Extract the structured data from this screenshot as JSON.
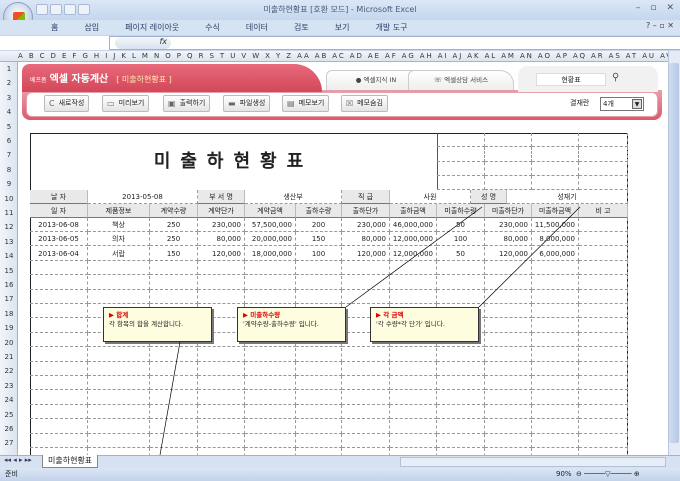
{
  "window": {
    "title": "미출하현황표  [호환 모드] - Microsoft Excel",
    "controls": [
      "–",
      "▫",
      "✕"
    ]
  },
  "ribbon": {
    "tabs": [
      "홈",
      "삽입",
      "페이지 레이아웃",
      "수식",
      "데이터",
      "검토",
      "보기",
      "개발 도구"
    ],
    "right": "? – ▫ ✕"
  },
  "formula_bar": {
    "fx": "fx",
    "value": ""
  },
  "columns": "A B C D E F G H I J K L M N O P Q R S T U V W X Y Z AA AB AC AD AE AF AG AH AI AJ AK AL AM AN AO AP AQ AR AS AT AU AV AW AX AY AZ BB BC BE",
  "banner": {
    "brand_small": "베프폼",
    "brand": "엑셀 자동계산",
    "subtitle": "[ 미출하현황표 ]",
    "tab1": "엑셀지식 IN",
    "tab2": "엑셀상담 서비스",
    "search_value": "현황표"
  },
  "toolbar": {
    "buttons": [
      "새로작성",
      "미리보기",
      "출력하기",
      "파일생성",
      "메모보기",
      "메모숨김"
    ],
    "approval_label": "결재란",
    "approval_value": "4개"
  },
  "form": {
    "title": "미출하현황표",
    "info": {
      "date_label": "날 자",
      "date": "2013-05-08",
      "dept_label": "부 서 명",
      "dept": "생산부",
      "rank_label": "직 급",
      "rank": "사원",
      "name_label": "성 명",
      "name": "성재기"
    },
    "headers": [
      "일 자",
      "제품정보",
      "계약수량",
      "계약단가",
      "계약금액",
      "출하수량",
      "출하단가",
      "출하금액",
      "미출하수량",
      "미출하단가",
      "미출하금액",
      "비 고"
    ],
    "rows": [
      [
        "2013-06-08",
        "책상",
        "250",
        "230,000",
        "57,500,000",
        "200",
        "230,000",
        "46,000,000",
        "50",
        "230,000",
        "11,500,000",
        ""
      ],
      [
        "2013-06-05",
        "의자",
        "250",
        "80,000",
        "20,000,000",
        "150",
        "80,000",
        "12,000,000",
        "100",
        "80,000",
        "8,000,000",
        ""
      ],
      [
        "2013-06-04",
        "서랍",
        "150",
        "120,000",
        "18,000,000",
        "100",
        "120,000",
        "12,000,000",
        "50",
        "120,000",
        "6,000,000",
        ""
      ]
    ]
  },
  "notes": [
    {
      "title": "합계",
      "body": "각 항목의 합을 계산합니다."
    },
    {
      "title": "미출하수량",
      "body": "'계약수량-출하수량' 입니다."
    },
    {
      "title": "각 금액",
      "body": "'각 수량*각 단가' 입니다."
    }
  ],
  "sheet_tab": "미출하현황표",
  "status": {
    "ready": "준비",
    "zoom": "90%"
  }
}
